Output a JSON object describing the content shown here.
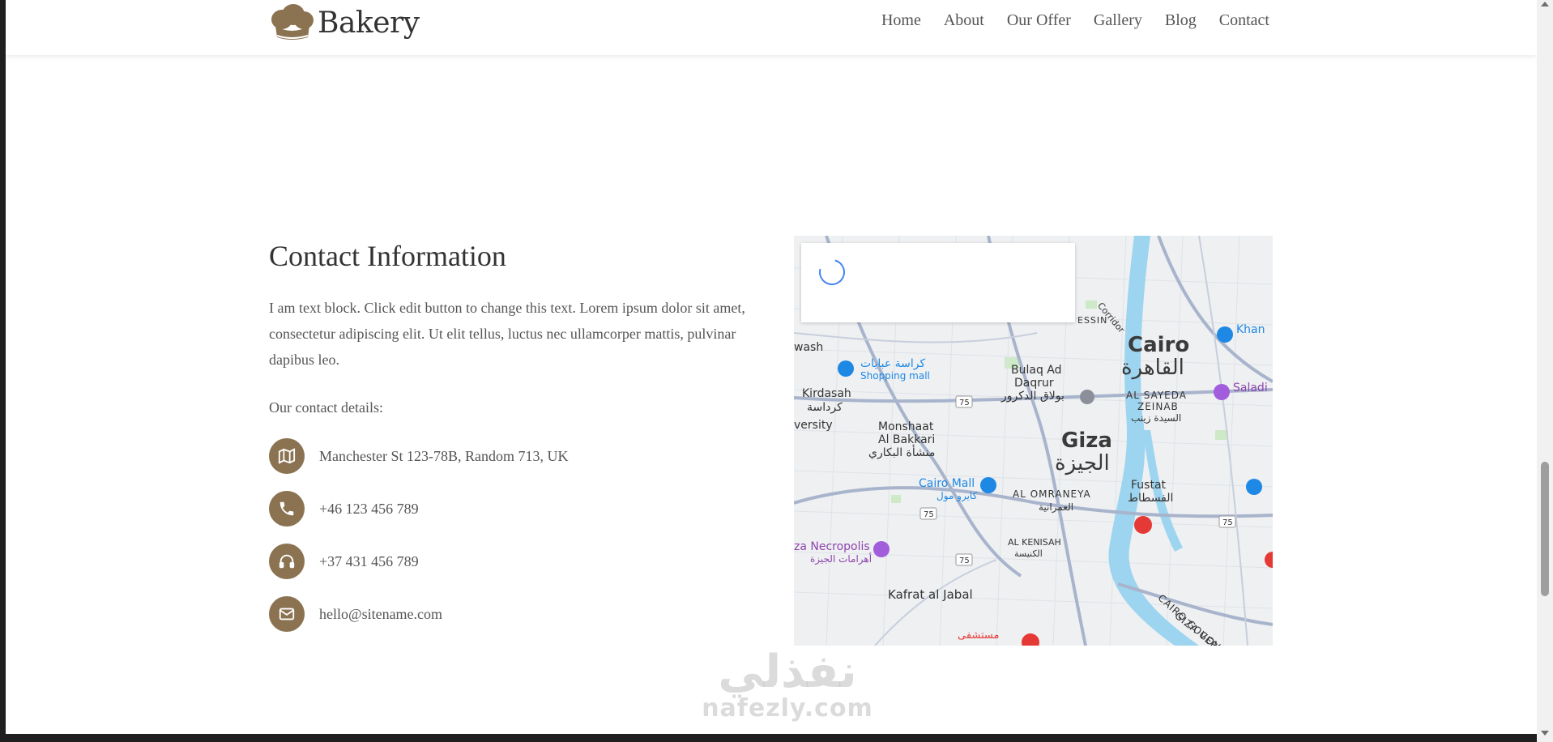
{
  "header": {
    "logo_text": "Bakery",
    "nav": [
      "Home",
      "About",
      "Our Offer",
      "Gallery",
      "Blog",
      "Contact"
    ]
  },
  "contact": {
    "title": "Contact Information",
    "text": "I am text block. Click edit button to change this text. Lorem ipsum dolor sit amet, consectetur adipiscing elit. Ut elit tellus, luctus nec ullamcorper mattis, pulvinar dapibus leo.",
    "details_label": "Our contact details:",
    "items": [
      {
        "icon": "map-icon",
        "text": "Manchester St 123-78B, Random 713, UK"
      },
      {
        "icon": "phone-icon",
        "text": "+46 123 456 789"
      },
      {
        "icon": "headphones-icon",
        "text": "+37 431 456 789"
      },
      {
        "icon": "envelope-icon",
        "text": "hello@sitename.com"
      }
    ]
  },
  "map": {
    "labels": {
      "cairo_en": "Cairo",
      "cairo_ar": "القاهرة",
      "giza_en": "Giza",
      "giza_ar": "الجيزة",
      "bulaq_en": "Bulaq Ad",
      "bulaq_en2": "Daqrur",
      "bulaq_ar": "بولاق الدكرور",
      "kirdasah_en": "Kirdasah",
      "kirdasah_ar": "كرداسة",
      "monshaat_en": "Monshaat",
      "monshaat_en2": "Al Bakkari",
      "monshaat_ar": "منشأة البكاري",
      "cairo_mall_en": "Cairo Mall",
      "cairo_mall_ar": "كايرو مول",
      "omraneya_en": "AL OMRANEYA",
      "omraneya_ar": "العمرانية",
      "fustat_en": "Fustat",
      "fustat_ar": "الفسطاط",
      "sayeda_en": "AL SAYEDA",
      "sayeda_en2": "ZEINAB",
      "sayeda_ar": "السيدة زينب",
      "kenisah_en": "AL KENISAH",
      "kenisah_ar": "الكنيسة",
      "necropolis_en": "za Necropolis",
      "necropolis_ar": "أهرامات الجيزة",
      "kafrat_en": "Kafrat al Jabal",
      "shopping_ar": "كراسة عبايات",
      "shopping_en": "Shopping mall",
      "khan": "Khan",
      "saladin": "Saladi",
      "cairo_gov": "CAIRO GOVERNOR",
      "giza_gov": "GIZA GOVE",
      "wash": "wash",
      "versity": "versity",
      "road75": "75",
      "hospital_ar": "مستشفى",
      "corridor": "Corridor",
      "essin": "ESSIN"
    }
  },
  "watermark": {
    "ar": "نفذلي",
    "en": "nafezly.com"
  },
  "colors": {
    "accent": "#8b7352",
    "water": "#9dd5f0",
    "road": "#a8b4cc"
  }
}
